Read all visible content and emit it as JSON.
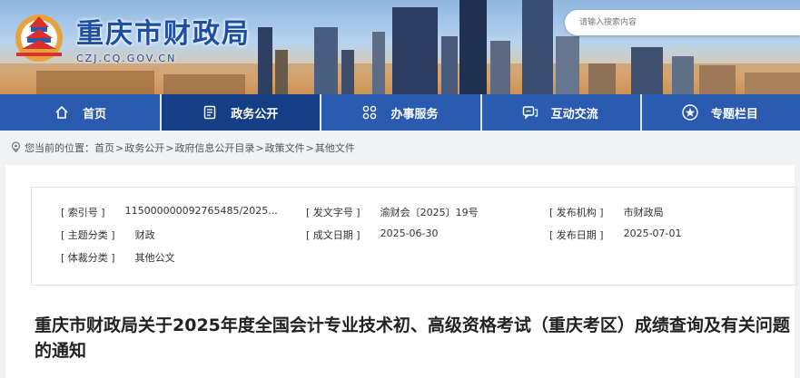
{
  "site": {
    "title": "重庆市财政局",
    "domain": "CZJ.CQ.GOV.CN"
  },
  "search": {
    "placeholder": "请输入搜索内容"
  },
  "nav": [
    {
      "label": "首页",
      "icon": "home-icon"
    },
    {
      "label": "政务公开",
      "icon": "document-icon"
    },
    {
      "label": "办事服务",
      "icon": "grid-icon"
    },
    {
      "label": "互动交流",
      "icon": "chat-icon"
    },
    {
      "label": "专题栏目",
      "icon": "star-icon"
    }
  ],
  "breadcrumb": {
    "prefix": "您当前的位置：",
    "items": [
      "首页",
      "政务公开",
      "政府信息公开目录",
      "政策文件",
      "其他文件"
    ],
    "separator": ">"
  },
  "meta": {
    "index_label": "[ 索引号 ]",
    "index_value": "115000000092765485/2025...",
    "doc_no_label": "[ 发文字号 ]",
    "doc_no_value": "渝财会〔2025〕19号",
    "issuer_label": "[ 发布机构 ]",
    "issuer_value": "市财政局",
    "topic_label": "[ 主题分类 ]",
    "topic_value": "财政",
    "created_label": "[ 成文日期 ]",
    "created_value": "2025-06-30",
    "published_label": "[ 发布日期 ]",
    "published_value": "2025-07-01",
    "genre_label": "[ 体裁分类 ]",
    "genre_value": "其他公文"
  },
  "article": {
    "title": "重庆市财政局关于2025年度全国会计专业技术初、高级资格考试（重庆考区）成绩查询及有关问题的通知"
  },
  "colors": {
    "nav_bg": "#2a5bb0",
    "nav_active": "#143f86",
    "brand": "#1f4fa3"
  }
}
